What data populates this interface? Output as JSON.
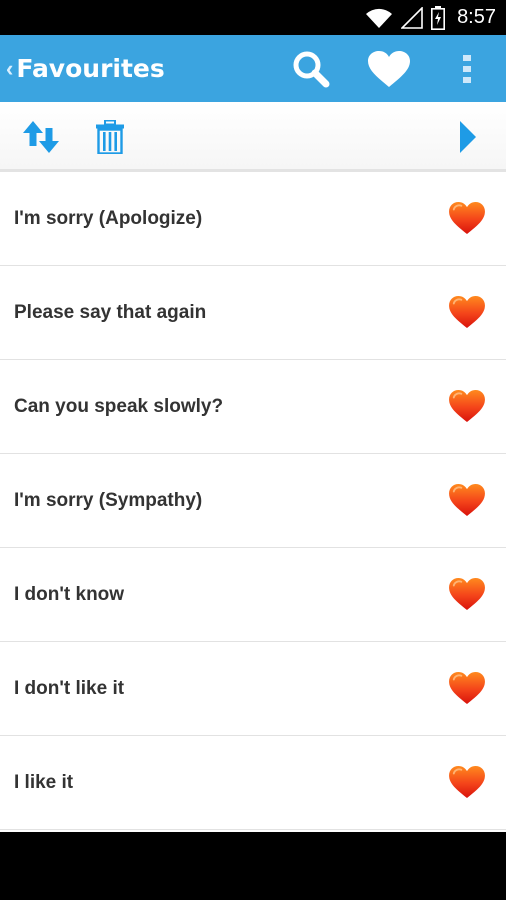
{
  "status_bar": {
    "time": "8:57"
  },
  "app_bar": {
    "back": "‹",
    "title": "Favourites"
  },
  "icons": {
    "search": "search-icon",
    "favourites": "heart-icon",
    "overflow": "more-vert-icon",
    "sort": "sort-arrows-icon",
    "delete": "trash-icon",
    "next": "play-arrow-icon"
  },
  "colors": {
    "app_bar": "#3ba4e0",
    "toolbar_icon": "#1e9be6",
    "heart_top": "#ff7a1a",
    "heart_bottom": "#e8170f"
  },
  "favourites": [
    {
      "label": "I'm sorry (Apologize)"
    },
    {
      "label": "Please say that again"
    },
    {
      "label": "Can you speak slowly?"
    },
    {
      "label": "I'm sorry (Sympathy)"
    },
    {
      "label": "I don't know"
    },
    {
      "label": "I don't like it"
    },
    {
      "label": "I like it"
    }
  ]
}
